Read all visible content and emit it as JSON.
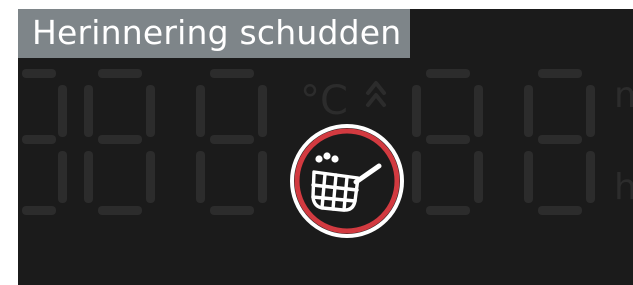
{
  "notification": {
    "title": "Herinnering schudden",
    "icon": "shake-basket-icon",
    "ring_color": "#d23a40",
    "icon_color": "#ffffff",
    "background_color": "#1b1b1b",
    "title_bar_color": "#7e8589"
  },
  "display": {
    "temperature_unit": "°C",
    "temperature_indicator_icon": "double-chevron-up-icon",
    "time_unit_top": "m",
    "time_unit_bottom": "h",
    "segment_color_off": "#2c2c2c"
  }
}
